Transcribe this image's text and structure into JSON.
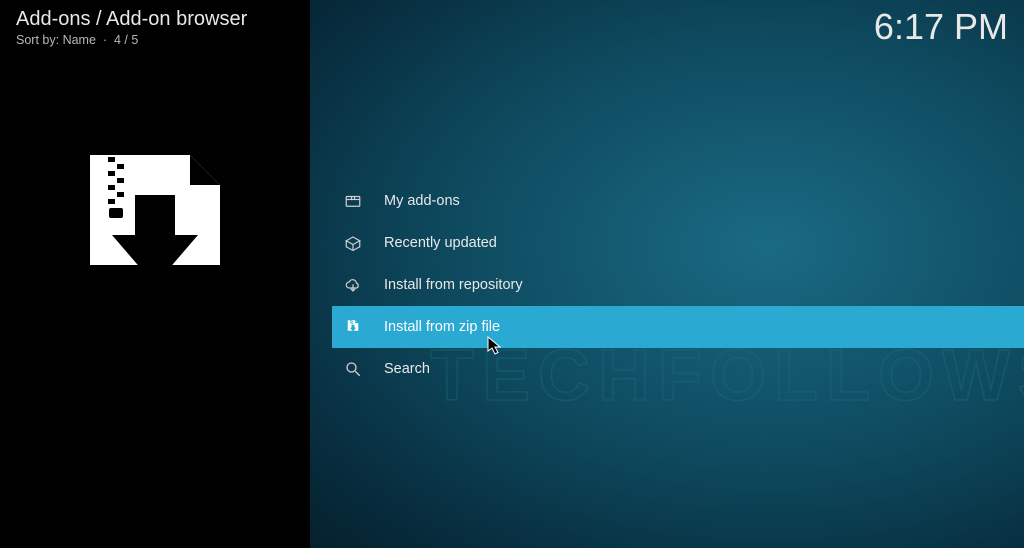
{
  "header": {
    "breadcrumb": "Add-ons / Add-on browser",
    "sort_label": "Sort by:",
    "sort_value": "Name",
    "position": "4 / 5",
    "clock": "6:17 PM"
  },
  "menu": {
    "items": [
      {
        "icon": "box-icon",
        "label": "My add-ons",
        "selected": false
      },
      {
        "icon": "open-box-icon",
        "label": "Recently updated",
        "selected": false
      },
      {
        "icon": "cloud-down-icon",
        "label": "Install from repository",
        "selected": false
      },
      {
        "icon": "zip-file-icon",
        "label": "Install from zip file",
        "selected": true
      },
      {
        "icon": "search-icon",
        "label": "Search",
        "selected": false
      }
    ]
  },
  "watermark": "TECHFOLLOWS"
}
